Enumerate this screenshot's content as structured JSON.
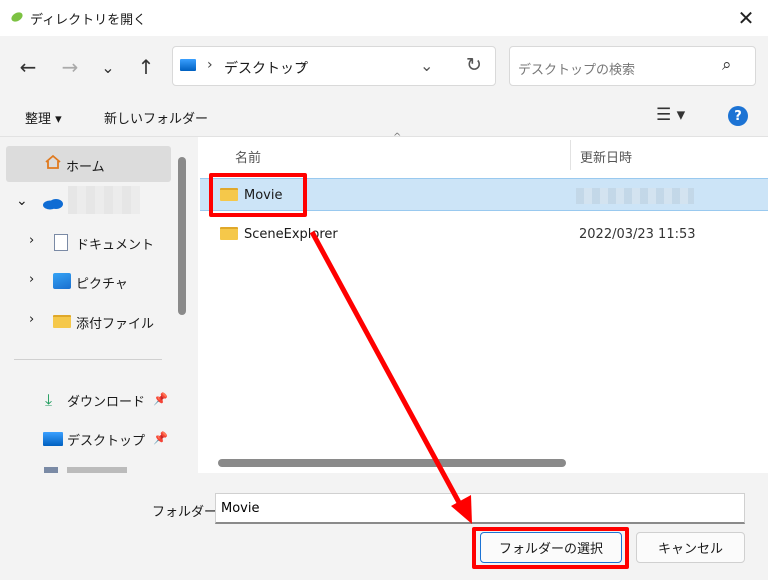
{
  "window": {
    "title": "ディレクトリを開く",
    "close_glyph": "✕"
  },
  "nav": {
    "back_glyph": "←",
    "forward_glyph": "→",
    "recent_glyph": "⌄",
    "up_glyph": "↑",
    "address_sep": "›",
    "address_path": "デスクトップ",
    "address_dropdown_glyph": "⌄",
    "refresh_glyph": "↻",
    "search_placeholder": "デスクトップの検索",
    "search_glyph": "⌕"
  },
  "commands": {
    "organize": "整理 ▾",
    "new_folder": "新しいフォルダー",
    "view_glyph": "☰ ▾",
    "help_glyph": "?"
  },
  "sidebar": {
    "expand_glyph": "›",
    "collapse_glyph": "⌄",
    "home": "ホーム",
    "documents": "ドキュメント",
    "pictures": "ピクチャ",
    "attachments": "添付ファイル",
    "downloads": "ダウンロード",
    "desktop": "デスクトップ",
    "pin_glyph": "📌"
  },
  "columns": {
    "name": "名前",
    "modified": "更新日時",
    "sort_glyph": "^"
  },
  "files": [
    {
      "name": "Movie",
      "modified": ""
    },
    {
      "name": "SceneExplorer",
      "modified": "2022/03/23 11:53"
    }
  ],
  "bottom": {
    "folder_label": "フォルダー:",
    "folder_value": "Movie",
    "select_button": "フォルダーの選択",
    "cancel_button": "キャンセル"
  },
  "colors": {
    "annotation": "#ff0000",
    "selection": "#cce4f7",
    "accent": "#1c73d4"
  }
}
